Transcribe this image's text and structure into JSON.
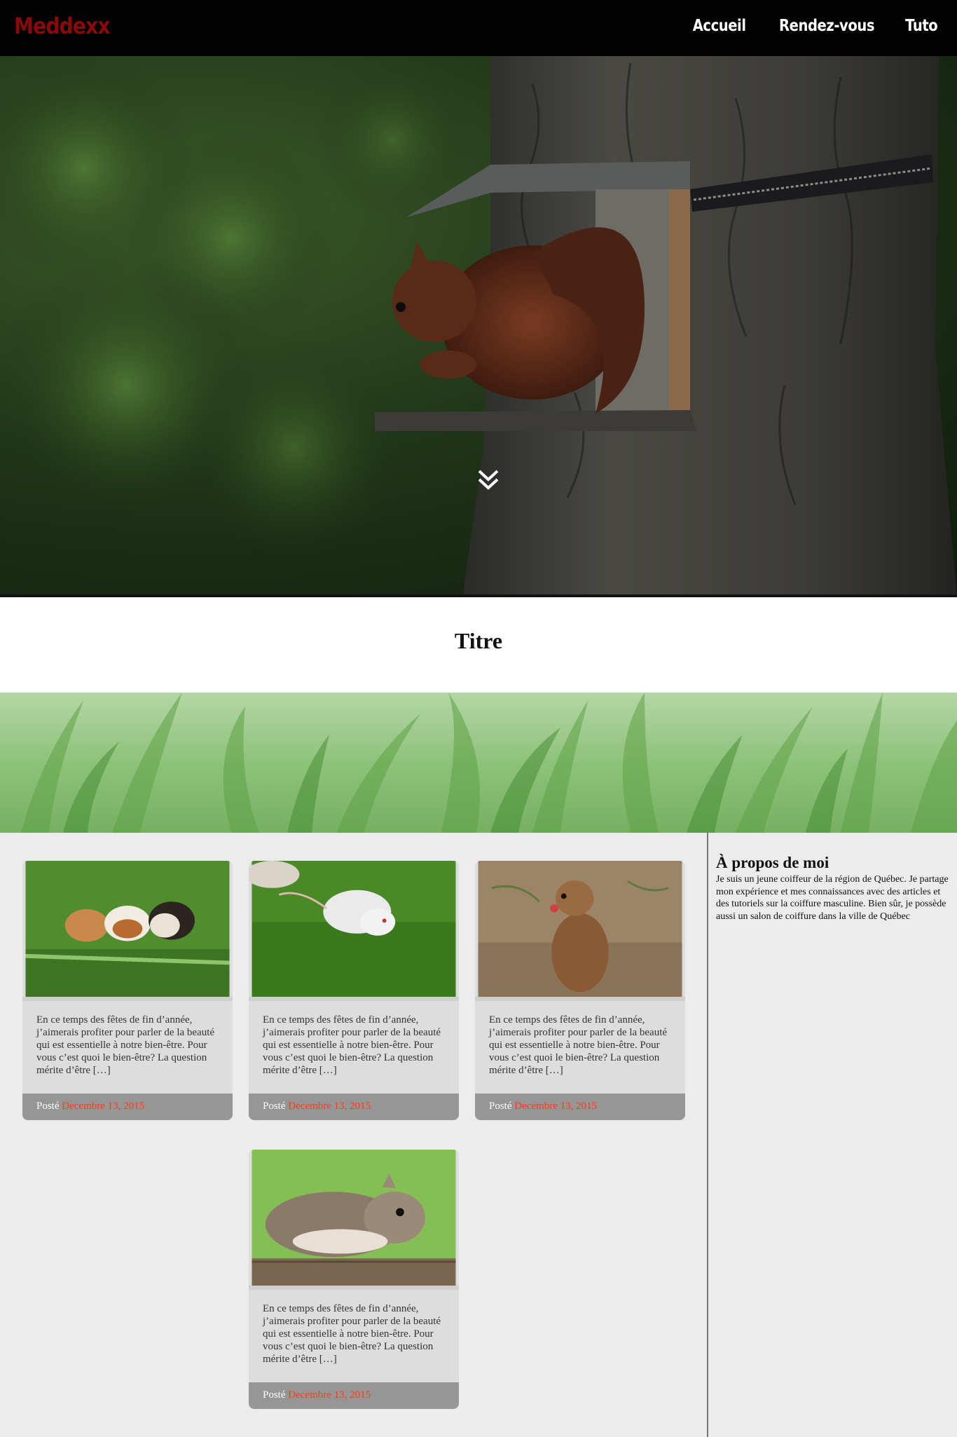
{
  "nav": {
    "brand": "Meddexx",
    "items": [
      {
        "label": "Accueil"
      },
      {
        "label": "Rendez-vous"
      },
      {
        "label": "Tuto"
      }
    ]
  },
  "hero": {
    "scroll_icon": "double-chevron-down-icon"
  },
  "page": {
    "title": "Titre"
  },
  "posts": [
    {
      "image": "guinea-pigs-photo",
      "excerpt": "En ce temps des fêtes de fin d’année, j’aimerais profiter pour parler de la beauté qui est essentielle à notre bien-être. Pour vous c’est quoi le bien-être? La question mérite d’être […]",
      "posted_label": "Posté",
      "date": "Decembre 13, 2015"
    },
    {
      "image": "white-rat-photo",
      "excerpt": "En ce temps des fêtes de fin d’année, j’aimerais profiter pour parler de la beauté qui est essentielle à notre bien-être. Pour vous c’est quoi le bien-être? La question mérite d’être […]",
      "posted_label": "Posté",
      "date": "Decembre 13, 2015"
    },
    {
      "image": "prairie-dog-photo",
      "excerpt": "En ce temps des fêtes de fin d’année, j’aimerais profiter pour parler de la beauté qui est essentielle à notre bien-être. Pour vous c’est quoi le bien-être? La question mérite d’être […]",
      "posted_label": "Posté",
      "date": "Decembre 13, 2015"
    },
    {
      "image": "grey-squirrel-photo",
      "excerpt": "En ce temps des fêtes de fin d’année, j’aimerais profiter pour parler de la beauté qui est essentielle à notre bien-être. Pour vous c’est quoi le bien-être? La question mérite d’être […]",
      "posted_label": "Posté",
      "date": "Decembre 13, 2015"
    }
  ],
  "sidebar": {
    "heading": "À propos de moi",
    "text": "Je suis un jeune coiffeur de la région de Québec. Je partage mon expérience et mes connaissances avec des articles et des tutoriels sur la coiffure masculine. Bien sûr, je possède aussi un salon de coiffure dans la ville de Québec"
  },
  "colors": {
    "nav_bg": "#030303",
    "brand": "#8a0a0a",
    "date_accent": "#ff3a1a",
    "card_bg": "#dddddd",
    "card_footer": "#969696",
    "page_bg": "#ececec"
  }
}
